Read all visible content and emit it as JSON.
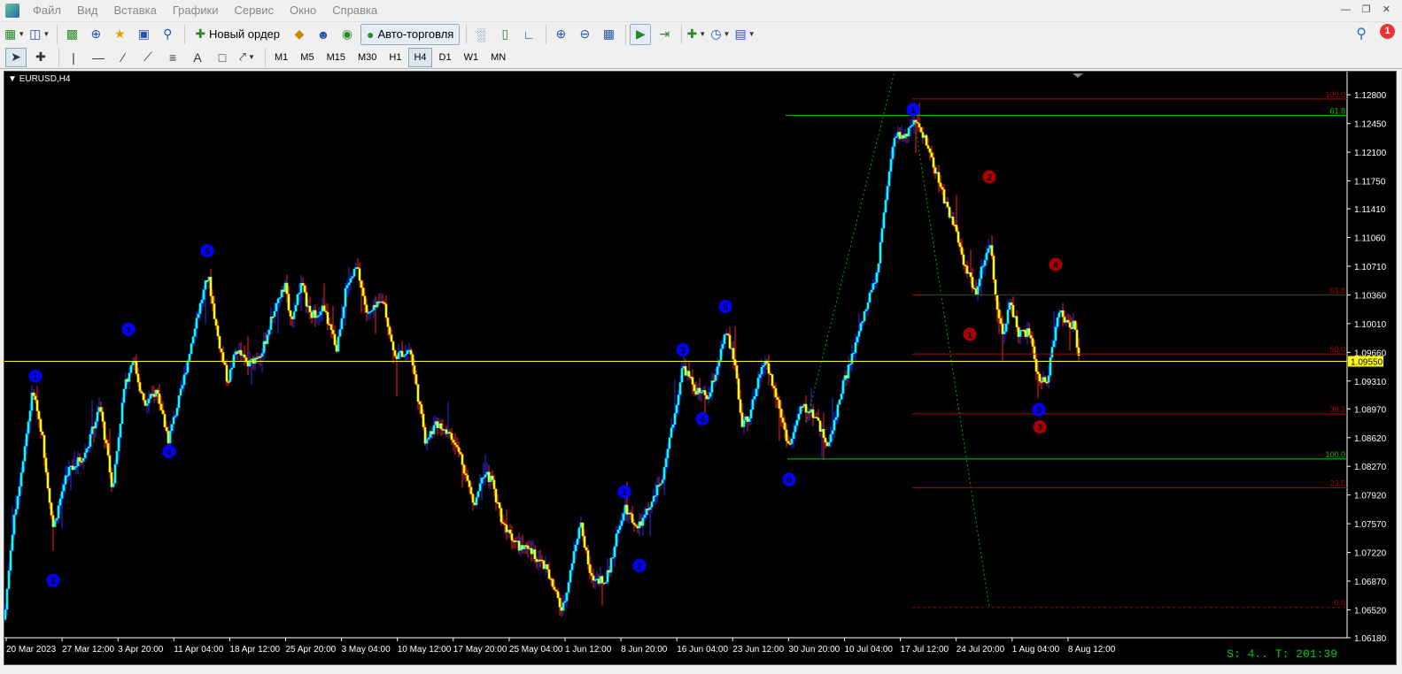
{
  "menu": {
    "items": [
      "Файл",
      "Вид",
      "Вставка",
      "Графики",
      "Сервис",
      "Окно",
      "Справка"
    ]
  },
  "toolbar": {
    "new_order_label": "Новый ордер",
    "auto_trading_label": "Авто-торговля",
    "notification_count": "1"
  },
  "timeframes": [
    "M1",
    "M5",
    "M15",
    "M30",
    "H1",
    "H4",
    "D1",
    "W1",
    "MN"
  ],
  "active_timeframe": "H4",
  "chart": {
    "symbol_label": "EURUSD,H4",
    "status_text": "S: 4.. T: 201:39",
    "current_price_label": "1.09550",
    "colors": {
      "background": "#000000",
      "bull": "#00ffff",
      "bear": "#ffff00",
      "wick_up": "#2030ff",
      "wick_down": "#ff2020",
      "current_price_line": "#ffff00",
      "fib_red": "#b00000",
      "fib_green": "#00cc00",
      "wave_blue": "#0000ff",
      "wave_red": "#aa0000"
    }
  },
  "chart_data": {
    "type": "candlestick",
    "price_ticks": [
      "1.12800",
      "1.12450",
      "1.12100",
      "1.11750",
      "1.11410",
      "1.11060",
      "1.10710",
      "1.10360",
      "1.10010",
      "1.09660",
      "1.09310",
      "1.08970",
      "1.08620",
      "1.08270",
      "1.07920",
      "1.07570",
      "1.07220",
      "1.06870",
      "1.06520",
      "1.06180"
    ],
    "date_ticks": [
      "20 Mar 2023",
      "27 Mar 12:00",
      "3 Apr 20:00",
      "11 Apr 04:00",
      "18 Apr 12:00",
      "25 Apr 20:00",
      "3 May 04:00",
      "10 May 12:00",
      "17 May 20:00",
      "25 May 04:00",
      "1 Jun 12:00",
      "8 Jun 20:00",
      "16 Jun 04:00",
      "23 Jun 12:00",
      "30 Jun 20:00",
      "10 Jul 04:00",
      "17 Jul 12:00",
      "24 Jul 20:00",
      "1 Aug 04:00",
      "8 Aug 12:00"
    ],
    "ylim": [
      1.0618,
      1.1305
    ],
    "current_price": 1.0955,
    "path_keypoints": [
      [
        0,
        1.064
      ],
      [
        8,
        1.074
      ],
      [
        20,
        1.083
      ],
      [
        32,
        1.092
      ],
      [
        42,
        1.087
      ],
      [
        55,
        1.075
      ],
      [
        70,
        1.082
      ],
      [
        90,
        1.084
      ],
      [
        108,
        1.09
      ],
      [
        122,
        1.08
      ],
      [
        135,
        1.092
      ],
      [
        145,
        1.096
      ],
      [
        158,
        1.09
      ],
      [
        172,
        1.092
      ],
      [
        185,
        1.086
      ],
      [
        200,
        1.092
      ],
      [
        215,
        1.1
      ],
      [
        230,
        1.106
      ],
      [
        240,
        1.099
      ],
      [
        252,
        1.093
      ],
      [
        262,
        1.097
      ],
      [
        275,
        1.095
      ],
      [
        292,
        1.097
      ],
      [
        305,
        1.102
      ],
      [
        318,
        1.105
      ],
      [
        322,
        1.1
      ],
      [
        335,
        1.105
      ],
      [
        345,
        1.101
      ],
      [
        360,
        1.102
      ],
      [
        375,
        1.097
      ],
      [
        385,
        1.104
      ],
      [
        398,
        1.107
      ],
      [
        410,
        1.101
      ],
      [
        428,
        1.103
      ],
      [
        440,
        1.096
      ],
      [
        458,
        1.097
      ],
      [
        475,
        1.086
      ],
      [
        490,
        1.088
      ],
      [
        500,
        1.087
      ],
      [
        515,
        1.084
      ],
      [
        530,
        1.078
      ],
      [
        540,
        1.082
      ],
      [
        550,
        1.081
      ],
      [
        562,
        1.076
      ],
      [
        580,
        1.073
      ],
      [
        598,
        1.072
      ],
      [
        612,
        1.07
      ],
      [
        630,
        1.065
      ],
      [
        650,
        1.076
      ],
      [
        662,
        1.069
      ],
      [
        680,
        1.069
      ],
      [
        700,
        1.078
      ],
      [
        715,
        1.075
      ],
      [
        730,
        1.078
      ],
      [
        745,
        1.082
      ],
      [
        758,
        1.09
      ],
      [
        766,
        1.095
      ],
      [
        780,
        1.092
      ],
      [
        795,
        1.091
      ],
      [
        805,
        1.095
      ],
      [
        815,
        1.099
      ],
      [
        825,
        1.095
      ],
      [
        832,
        1.088
      ],
      [
        842,
        1.089
      ],
      [
        858,
        1.096
      ],
      [
        872,
        1.091
      ],
      [
        886,
        1.085
      ],
      [
        900,
        1.09
      ],
      [
        915,
        1.089
      ],
      [
        930,
        1.085
      ],
      [
        945,
        1.092
      ],
      [
        960,
        1.097
      ],
      [
        970,
        1.101
      ],
      [
        985,
        1.106
      ],
      [
        995,
        1.115
      ],
      [
        1005,
        1.123
      ],
      [
        1018,
        1.123
      ],
      [
        1028,
        1.1245
      ],
      [
        1038,
        1.123
      ],
      [
        1050,
        1.119
      ],
      [
        1062,
        1.115
      ],
      [
        1075,
        1.111
      ],
      [
        1085,
        1.107
      ],
      [
        1097,
        1.104
      ],
      [
        1106,
        1.108
      ],
      [
        1113,
        1.11
      ],
      [
        1120,
        1.103
      ],
      [
        1128,
        1.098
      ],
      [
        1135,
        1.103
      ],
      [
        1145,
        1.099
      ],
      [
        1157,
        1.099
      ],
      [
        1168,
        1.093
      ],
      [
        1178,
        1.0935
      ],
      [
        1190,
        1.102
      ],
      [
        1200,
        1.1
      ],
      [
        1208,
        1.1
      ],
      [
        1214,
        1.095
      ]
    ],
    "fibo_levels": [
      {
        "label": "100.0",
        "price": 1.1275,
        "color": "red"
      },
      {
        "label": "61.8",
        "price": 1.1036,
        "color": "red"
      },
      {
        "label": "50.0",
        "price": 1.0964,
        "color": "red"
      },
      {
        "label": "38.2",
        "price": 1.0891,
        "color": "red"
      },
      {
        "label": "23.6",
        "price": 1.0801,
        "color": "red"
      },
      {
        "label": "0.0",
        "price": 1.0655,
        "color": "red"
      },
      {
        "label": "61.8",
        "price": 1.1255,
        "color": "green"
      },
      {
        "label": "100.0",
        "price": 1.0836,
        "color": "green"
      }
    ],
    "wave_labels": [
      {
        "text": "1",
        "x": 35,
        "price": 1.0937,
        "color": "blue"
      },
      {
        "text": "2",
        "x": 55,
        "price": 1.0688,
        "color": "blue"
      },
      {
        "text": "3",
        "x": 140,
        "price": 1.0994,
        "color": "blue"
      },
      {
        "text": "4",
        "x": 186,
        "price": 1.0845,
        "color": "blue"
      },
      {
        "text": "5",
        "x": 229,
        "price": 1.109,
        "color": "blue"
      },
      {
        "text": "1",
        "x": 700,
        "price": 1.0796,
        "color": "blue"
      },
      {
        "text": "2",
        "x": 717,
        "price": 1.0706,
        "color": "blue"
      },
      {
        "text": "3",
        "x": 766,
        "price": 1.0969,
        "color": "blue"
      },
      {
        "text": "4",
        "x": 788,
        "price": 1.0885,
        "color": "blue"
      },
      {
        "text": "5",
        "x": 814,
        "price": 1.1022,
        "color": "blue"
      },
      {
        "text": "0",
        "x": 886,
        "price": 1.0811,
        "color": "blue"
      },
      {
        "text": "1",
        "x": 1026,
        "price": 1.1262,
        "color": "blue"
      },
      {
        "text": "3",
        "x": 1168,
        "price": 1.0896,
        "color": "blue"
      },
      {
        "text": "1",
        "x": 1090,
        "price": 1.0988,
        "color": "red"
      },
      {
        "text": "2",
        "x": 1112,
        "price": 1.118,
        "color": "red"
      },
      {
        "text": "3",
        "x": 1169,
        "price": 1.0875,
        "color": "red"
      },
      {
        "text": "4",
        "x": 1187,
        "price": 1.1073,
        "color": "red"
      }
    ]
  }
}
